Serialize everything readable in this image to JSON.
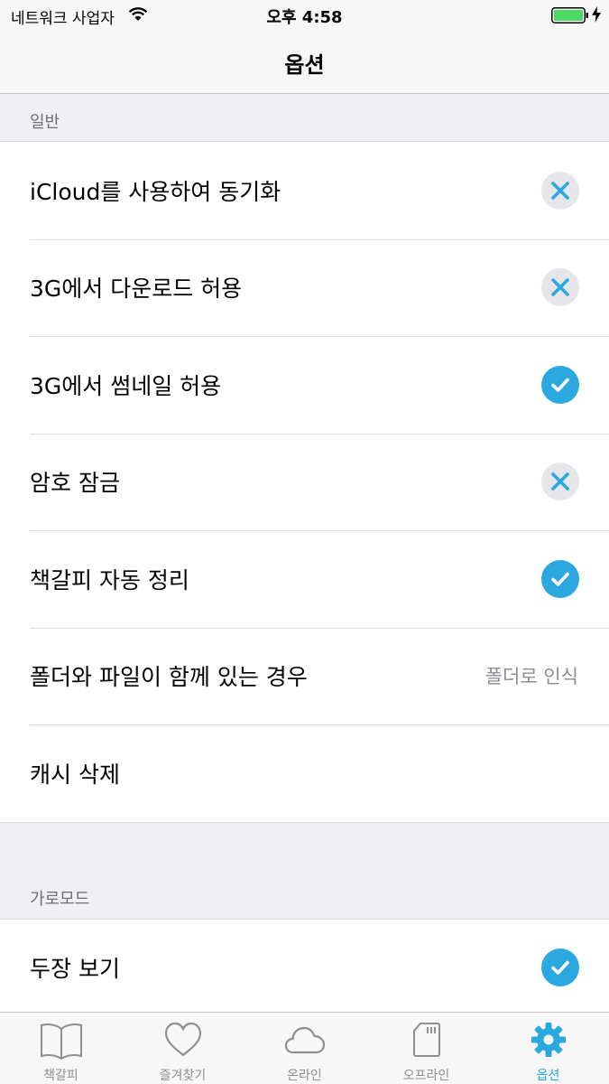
{
  "status_bar": {
    "carrier": "네트워크 사업자",
    "time": "오후 4:58"
  },
  "nav": {
    "title": "옵션"
  },
  "sections": {
    "general": {
      "header": "일반",
      "rows": [
        {
          "label": "iCloud를 사용하여 동기화",
          "state": "off"
        },
        {
          "label": "3G에서 다운로드 허용",
          "state": "off"
        },
        {
          "label": "3G에서 썸네일 허용",
          "state": "on"
        },
        {
          "label": "암호 잠금",
          "state": "off"
        },
        {
          "label": "책갈피 자동 정리",
          "state": "on"
        },
        {
          "label": "폴더와 파일이 함께 있는 경우",
          "value": "폴더로 인식"
        },
        {
          "label": "캐시 삭제"
        }
      ]
    },
    "landscape": {
      "header": "가로모드",
      "rows": [
        {
          "label": "두장 보기",
          "state": "on"
        }
      ]
    }
  },
  "tabs": [
    {
      "label": "책갈피",
      "icon": "book-icon"
    },
    {
      "label": "즐겨찾기",
      "icon": "heart-icon"
    },
    {
      "label": "온라인",
      "icon": "cloud-icon"
    },
    {
      "label": "오프라인",
      "icon": "sd-card-icon"
    },
    {
      "label": "옵션",
      "icon": "gear-icon",
      "active": true
    }
  ],
  "colors": {
    "accent": "#2aa8df",
    "toggle_off_bg": "#e5e5ea",
    "battery": "#4cd964",
    "secondary_text": "#8e8e93"
  }
}
